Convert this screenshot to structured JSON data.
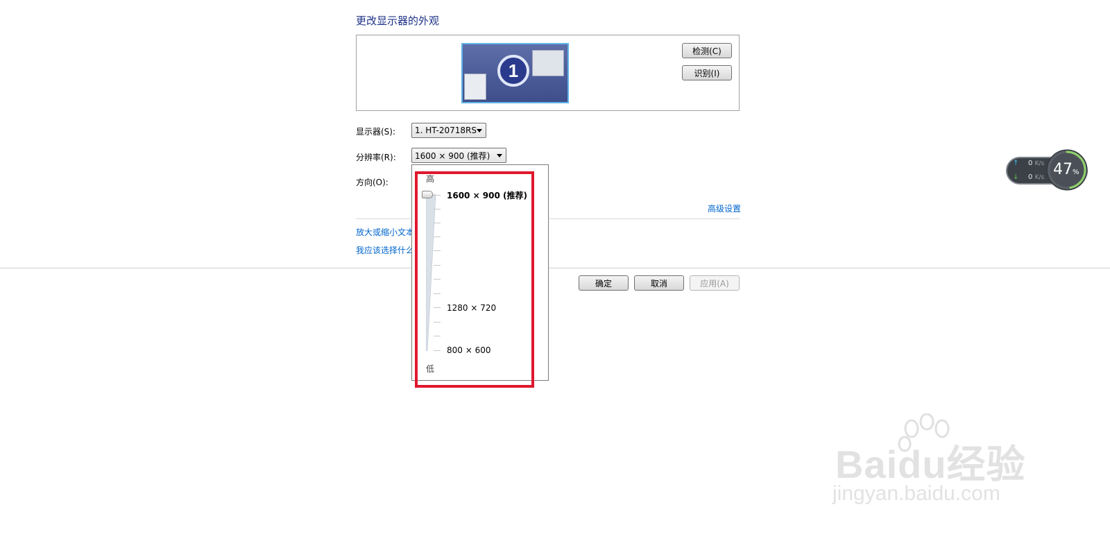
{
  "page": {
    "title": "更改显示器的外观"
  },
  "preview": {
    "monitor_number": "1"
  },
  "buttons": {
    "detect": "检测(C)",
    "identify": "识别(I)",
    "ok": "确定",
    "cancel": "取消",
    "apply": "应用(A)"
  },
  "form": {
    "display_label": "显示器(S):",
    "display_value": "1. HT-20718RS",
    "resolution_label": "分辨率(R):",
    "resolution_value": "1600 × 900 (推荐)",
    "orientation_label": "方向(O):"
  },
  "links": {
    "advanced": "高级设置",
    "text_size": "放大或缩小文本",
    "which_settings": "我应该选择什么"
  },
  "resolution_dropdown": {
    "high_label": "高",
    "low_label": "低",
    "options": [
      "1600 × 900 (推荐)",
      "1280 × 720",
      "800 × 600"
    ],
    "selected": "1600 × 900 (推荐)",
    "slider_level": 1.0
  },
  "net_widget": {
    "upload": "0",
    "download": "0",
    "unit": "K/s",
    "percent": "47",
    "percent_sign": "%"
  },
  "watermark": {
    "brand": "Baidu经验",
    "url": "jingyan.baidu.com"
  },
  "colors": {
    "title": "#1e3287",
    "link": "#0066cc",
    "highlight": "#e0182d"
  }
}
